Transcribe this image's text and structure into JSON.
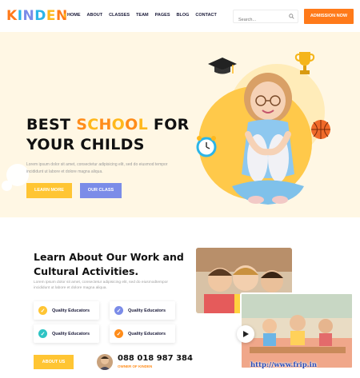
{
  "brand": {
    "letters": [
      {
        "ch": "K",
        "color": "#ff7a1a"
      },
      {
        "ch": "I",
        "color": "#2bb5e8"
      },
      {
        "ch": "N",
        "color": "#7b8ce8"
      },
      {
        "ch": "D",
        "color": "#2bb5e8"
      },
      {
        "ch": "E",
        "color": "#ffb81c"
      },
      {
        "ch": "N",
        "color": "#ff7a1a"
      }
    ]
  },
  "nav": {
    "items": [
      "HOME",
      "ABOUT",
      "CLASSES",
      "TEAM",
      "PAGES",
      "BLOG",
      "CONTACT"
    ],
    "active": "HOME"
  },
  "search": {
    "placeholder": "Search..."
  },
  "header": {
    "cta": "ADMISSION NOW"
  },
  "hero": {
    "title_pre": "BEST ",
    "title_accent_letters": [
      {
        "ch": "S",
        "color": "#ff8c1a"
      },
      {
        "ch": "C",
        "color": "#ffb81c"
      },
      {
        "ch": "H",
        "color": "#ff8c1a"
      },
      {
        "ch": "O",
        "color": "#ffb81c"
      },
      {
        "ch": "O",
        "color": "#ff8c1a"
      },
      {
        "ch": "L",
        "color": "#ffb81c"
      }
    ],
    "title_post": " FOR",
    "title_line2": "YOUR CHILDS",
    "text": "Lorem ipsum dolor sit amet, consectetur adipisicing elit, sed do eiusmod tempor incididunt ut labore et dolore magna aliqua.",
    "btn_primary": "LEARN MORE",
    "btn_secondary": "OUR CLASS"
  },
  "about": {
    "title_line1": "Learn About Our Work and",
    "title_line2": "Cultural Activities.",
    "text": "Lorem ipsum dolor sit amet, consectetur adipisicing elit, sed do eiusmodtempor incididunt ut labore et dolore magna aliqua.",
    "features": [
      {
        "label": "Quality Educators",
        "color": "#ffc533"
      },
      {
        "label": "Quality Educators",
        "color": "#7b8ce8"
      },
      {
        "label": "Quality Educators",
        "color": "#2ec4c4"
      },
      {
        "label": "Quality Educators",
        "color": "#ff8c1a"
      }
    ],
    "btn": "ABOUT US",
    "phone": "088 018 987 384",
    "phone_caption": "OWNER OF KINDEN"
  },
  "watermark": "http://www.frip.in"
}
